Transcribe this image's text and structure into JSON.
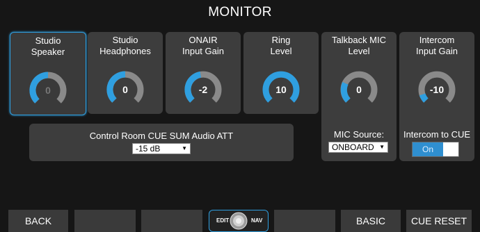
{
  "header": {
    "title": "MONITOR"
  },
  "knobs": [
    {
      "line1": "Studio",
      "line2": "Speaker",
      "value": "0"
    },
    {
      "line1": "Studio",
      "line2": "Headphones",
      "value": "0"
    },
    {
      "line1": "ONAIR",
      "line2": "Input Gain",
      "value": "-2"
    },
    {
      "line1": "Ring",
      "line2": "Level",
      "value": "10"
    },
    {
      "line1": "Talkback MIC",
      "line2": "Level",
      "value": "0"
    },
    {
      "line1": "Intercom",
      "line2": "Input Gain",
      "value": "-10"
    }
  ],
  "cue_sum": {
    "label": "Control Room CUE SUM Audio ATT",
    "value": "-15 dB"
  },
  "mic_source": {
    "label": "MIC Source:",
    "value": "ONBOARD"
  },
  "intercom_cue": {
    "label": "Intercom to CUE",
    "toggle": "On"
  },
  "encoder": {
    "left": "EDIT",
    "right": "NAV"
  },
  "buttons": {
    "back": "BACK",
    "basic": "BASIC",
    "cue_reset": "CUE RESET"
  },
  "colors": {
    "accent": "#2f9fe0",
    "track": "#8a8a8a",
    "panel": "#3d3d3d",
    "background": "#161616"
  }
}
